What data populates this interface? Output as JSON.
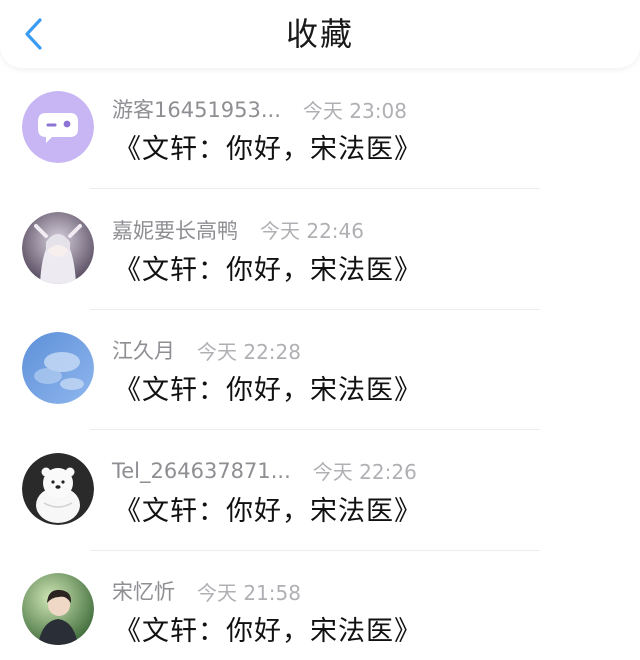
{
  "header": {
    "title": "收藏",
    "back_icon": "chevron-left-icon",
    "accent_color": "#3a9bf2"
  },
  "favorites": [
    {
      "user": "游客16451953...",
      "time": "今天 23:08",
      "content": "《文轩：你好，宋法医》",
      "avatar": "chat-bubble-avatar"
    },
    {
      "user": "嘉妮要长高鸭",
      "time": "今天 22:46",
      "content": "《文轩：你好，宋法医》",
      "avatar": "anime-girl-avatar"
    },
    {
      "user": "江久月",
      "time": "今天 22:28",
      "content": "《文轩：你好，宋法医》",
      "avatar": "blue-sky-avatar"
    },
    {
      "user": "Tel_264637871...",
      "time": "今天 22:26",
      "content": "《文轩：你好，宋法医》",
      "avatar": "polar-bear-avatar"
    },
    {
      "user": "宋忆忻",
      "time": "今天 21:58",
      "content": "《文轩：你好，宋法医》",
      "avatar": "portrait-photo-avatar"
    }
  ]
}
